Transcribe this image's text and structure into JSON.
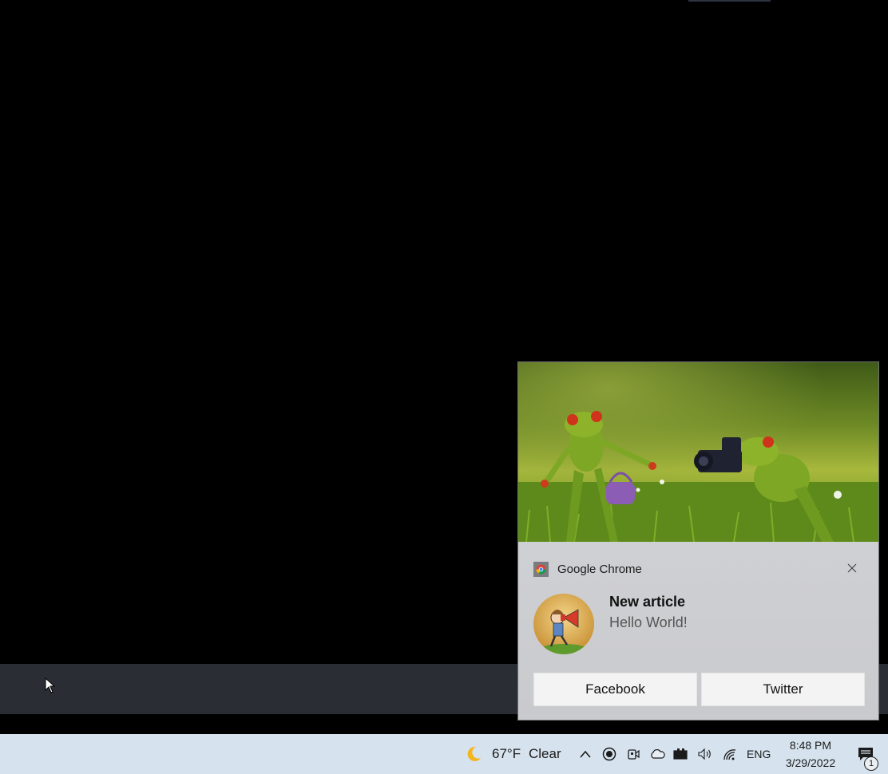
{
  "toast": {
    "app_name": "Google Chrome",
    "app_icon": "chrome-icon",
    "close_icon": "close-icon",
    "title": "New article",
    "body": "Hello World!",
    "hero_image": "frogs-photographer-image",
    "avatar_image": "cartoon-megaphone-avatar",
    "actions": [
      {
        "label": "Facebook"
      },
      {
        "label": "Twitter"
      }
    ]
  },
  "taskbar": {
    "weather_icon": "moon-icon",
    "temperature": "67°F",
    "condition": "Clear",
    "tray_icons": [
      "chevron-up-icon",
      "record-icon",
      "meet-now-icon",
      "onedrive-cloud-icon",
      "battery-icon",
      "volume-icon",
      "wifi-icon"
    ],
    "language": "ENG",
    "time": "8:48 PM",
    "date": "3/29/2022",
    "notification_count": "1",
    "notification_icon": "action-center-icon"
  },
  "colors": {
    "taskbar_bg": "#d6e3ee",
    "toast_bg": "#d0d1d4",
    "button_bg": "#f3f3f3",
    "desktop_bg": "#000000"
  }
}
